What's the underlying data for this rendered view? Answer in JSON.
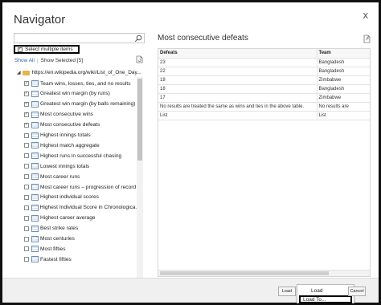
{
  "window": {
    "title": "Navigator",
    "close_glyph": "x"
  },
  "search": {
    "placeholder": "",
    "value": "",
    "icon": "search-icon"
  },
  "select_multiple": {
    "label": "Select multiple items",
    "checked": true
  },
  "filter_links": {
    "show_all": "Show All",
    "separator": "|",
    "show_selected": "Show Selected [5]"
  },
  "tree": {
    "root_label": "https://en.wikipedia.org/wiki/List_of_One_Day...",
    "items": [
      {
        "label": "Team wins, losses, ties, and no results",
        "checked": true
      },
      {
        "label": "Greatest win margin (by runs)",
        "checked": true
      },
      {
        "label": "Greatest win margin (by balls remaining)",
        "checked": true
      },
      {
        "label": "Most consecutive wins",
        "checked": true
      },
      {
        "label": "Most consecutive defeats",
        "checked": true
      },
      {
        "label": "Highest innings totals",
        "checked": false
      },
      {
        "label": "Highest match aggregate",
        "checked": false
      },
      {
        "label": "Highest runs in successful chasing",
        "checked": false
      },
      {
        "label": "Lowest innings totals",
        "checked": false
      },
      {
        "label": "Most career runs",
        "checked": false
      },
      {
        "label": "Most career runs – progression of record",
        "checked": false
      },
      {
        "label": "Highest individual scores",
        "checked": false
      },
      {
        "label": "Highest Individual Score in Chronologica...",
        "checked": false
      },
      {
        "label": "Highest career average",
        "checked": false
      },
      {
        "label": "Best strike rates",
        "checked": false
      },
      {
        "label": "Most centuries",
        "checked": false
      },
      {
        "label": "Most fifties",
        "checked": false
      },
      {
        "label": "Fastest fifties",
        "checked": false
      }
    ]
  },
  "preview": {
    "title": "Most consecutive defeats",
    "columns": [
      "Defeats",
      "Team"
    ],
    "rows": [
      [
        "23",
        "Bangladesh"
      ],
      [
        "22",
        "Bangladesh"
      ],
      [
        "18",
        "Zimbabwe"
      ],
      [
        "18",
        "Bangladesh"
      ],
      [
        "17",
        "Zimbabwe"
      ],
      [
        "No results are treated the same as wins and ties in the above table.",
        "No results are"
      ],
      [
        "List",
        "List"
      ]
    ]
  },
  "footer": {
    "load_label": "Load",
    "cancel_label": "Cancel",
    "dropdown": {
      "load": "Load",
      "load_to": "Load To..."
    }
  },
  "colors": {
    "link": "#2a5ea8",
    "folder": "#e8b54a",
    "highlight_border": "#000000"
  }
}
